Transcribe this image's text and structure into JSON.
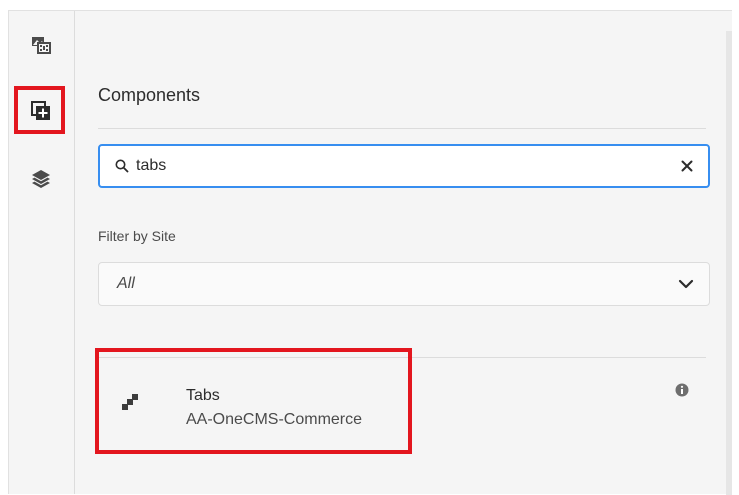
{
  "sidebar": {
    "items": [
      {
        "icon": "assets-icon"
      },
      {
        "icon": "components-icon"
      },
      {
        "icon": "layers-icon"
      }
    ]
  },
  "panel": {
    "title": "Components",
    "search": {
      "value": "tabs",
      "placeholder": ""
    },
    "filter": {
      "label": "Filter by Site",
      "selected": "All"
    },
    "results": [
      {
        "title": "Tabs",
        "subtitle": "AA-OneCMS-Commerce",
        "icon": "component-drag-icon"
      }
    ]
  },
  "colors": {
    "highlight": "#e3161e",
    "focus": "#378ef0"
  }
}
